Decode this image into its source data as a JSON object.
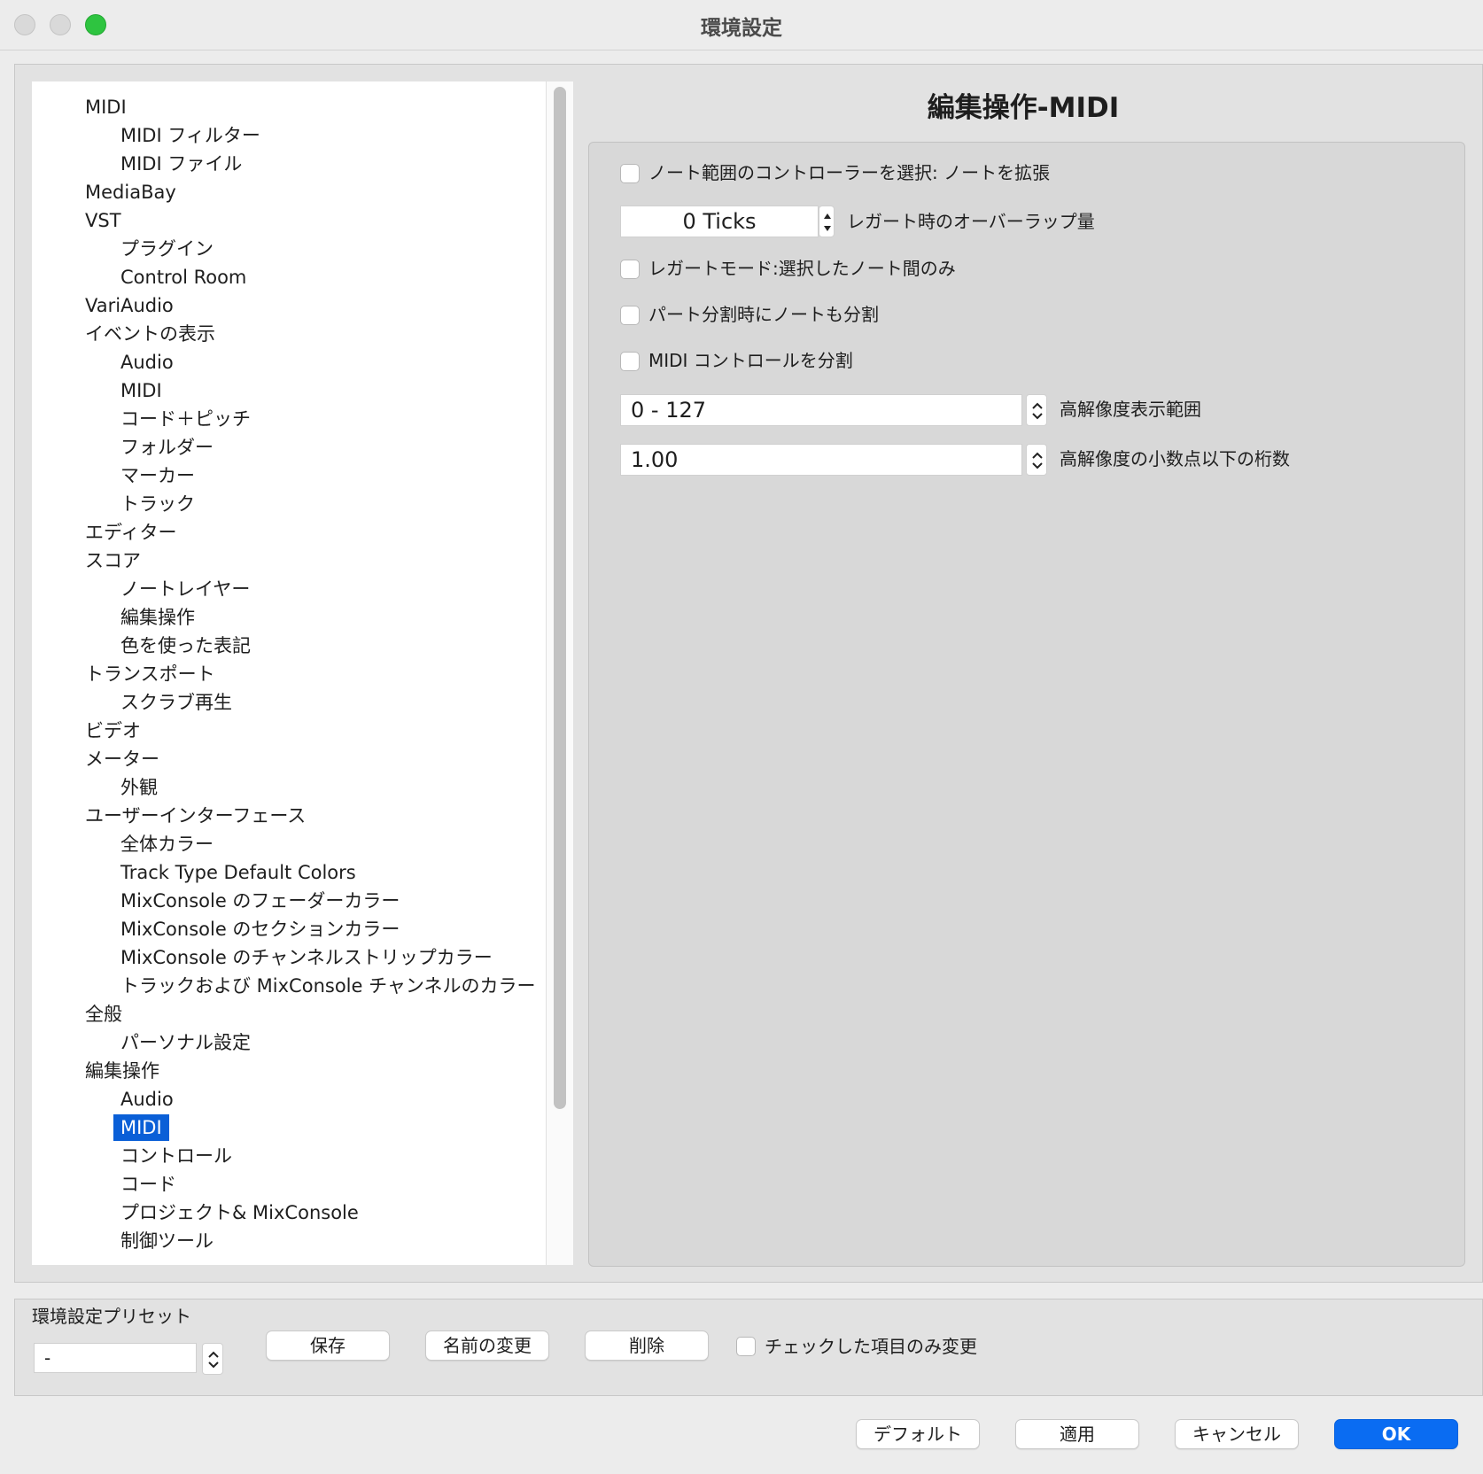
{
  "window": {
    "title": "環境設定"
  },
  "tree": {
    "items": [
      {
        "label": "MIDI",
        "level": 1
      },
      {
        "label": "MIDI フィルター",
        "level": 2
      },
      {
        "label": "MIDI ファイル",
        "level": 2
      },
      {
        "label": "MediaBay",
        "level": 1
      },
      {
        "label": "VST",
        "level": 1
      },
      {
        "label": "プラグイン",
        "level": 2
      },
      {
        "label": "Control Room",
        "level": 2
      },
      {
        "label": "VariAudio",
        "level": 1
      },
      {
        "label": "イベントの表示",
        "level": 1
      },
      {
        "label": "Audio",
        "level": 2
      },
      {
        "label": "MIDI",
        "level": 2
      },
      {
        "label": "コード＋ピッチ",
        "level": 2
      },
      {
        "label": "フォルダー",
        "level": 2
      },
      {
        "label": "マーカー",
        "level": 2
      },
      {
        "label": "トラック",
        "level": 2
      },
      {
        "label": "エディター",
        "level": 1
      },
      {
        "label": "スコア",
        "level": 1
      },
      {
        "label": "ノートレイヤー",
        "level": 2
      },
      {
        "label": "編集操作",
        "level": 2
      },
      {
        "label": "色を使った表記",
        "level": 2
      },
      {
        "label": "トランスポート",
        "level": 1
      },
      {
        "label": "スクラブ再生",
        "level": 2
      },
      {
        "label": "ビデオ",
        "level": 1
      },
      {
        "label": "メーター",
        "level": 1
      },
      {
        "label": "外観",
        "level": 2
      },
      {
        "label": "ユーザーインターフェース",
        "level": 1
      },
      {
        "label": "全体カラー",
        "level": 2
      },
      {
        "label": "Track Type Default Colors",
        "level": 2
      },
      {
        "label": "MixConsole のフェーダーカラー",
        "level": 2
      },
      {
        "label": "MixConsole のセクションカラー",
        "level": 2
      },
      {
        "label": "MixConsole のチャンネルストリップカラー",
        "level": 2
      },
      {
        "label": "トラックおよび MixConsole チャンネルのカラー",
        "level": 2
      },
      {
        "label": "全般",
        "level": 1
      },
      {
        "label": "パーソナル設定",
        "level": 2
      },
      {
        "label": "編集操作",
        "level": 1
      },
      {
        "label": "Audio",
        "level": 2
      },
      {
        "label": "MIDI",
        "level": 2,
        "selected": true
      },
      {
        "label": "コントロール",
        "level": 2
      },
      {
        "label": "コード",
        "level": 2
      },
      {
        "label": "プロジェクト& MixConsole",
        "level": 2
      },
      {
        "label": "制御ツール",
        "level": 2
      }
    ]
  },
  "panel": {
    "title": "編集操作-MIDI",
    "options": {
      "select_controllers": {
        "label": "ノート範囲のコントローラーを選択: ノートを拡張",
        "checked": false
      },
      "legato_overlap": {
        "value": "0 Ticks",
        "label": "レガート時のオーバーラップ量"
      },
      "legato_mode": {
        "label": "レガートモード:選択したノート間のみ",
        "checked": false
      },
      "split_notes": {
        "label": "パート分割時にノートも分割",
        "checked": false
      },
      "split_midi_controls": {
        "label": "MIDI コントロールを分割",
        "checked": false
      },
      "hires_range": {
        "value": "0 - 127",
        "label": "高解像度表示範囲"
      },
      "hires_decimals": {
        "value": "1.00",
        "label": "高解像度の小数点以下の桁数"
      }
    }
  },
  "preset": {
    "label": "環境設定プリセット",
    "value": "-",
    "save": "保存",
    "rename": "名前の変更",
    "delete": "削除",
    "checked_only": {
      "label": "チェックした項目のみ変更",
      "checked": false
    }
  },
  "footer": {
    "default": "デフォルト",
    "apply": "適用",
    "cancel": "キャンセル",
    "ok": "OK"
  },
  "colors": {
    "selection": "#0a5fd7",
    "primary_button": "#0a6cf2",
    "zoom_button": "#2ec440"
  }
}
